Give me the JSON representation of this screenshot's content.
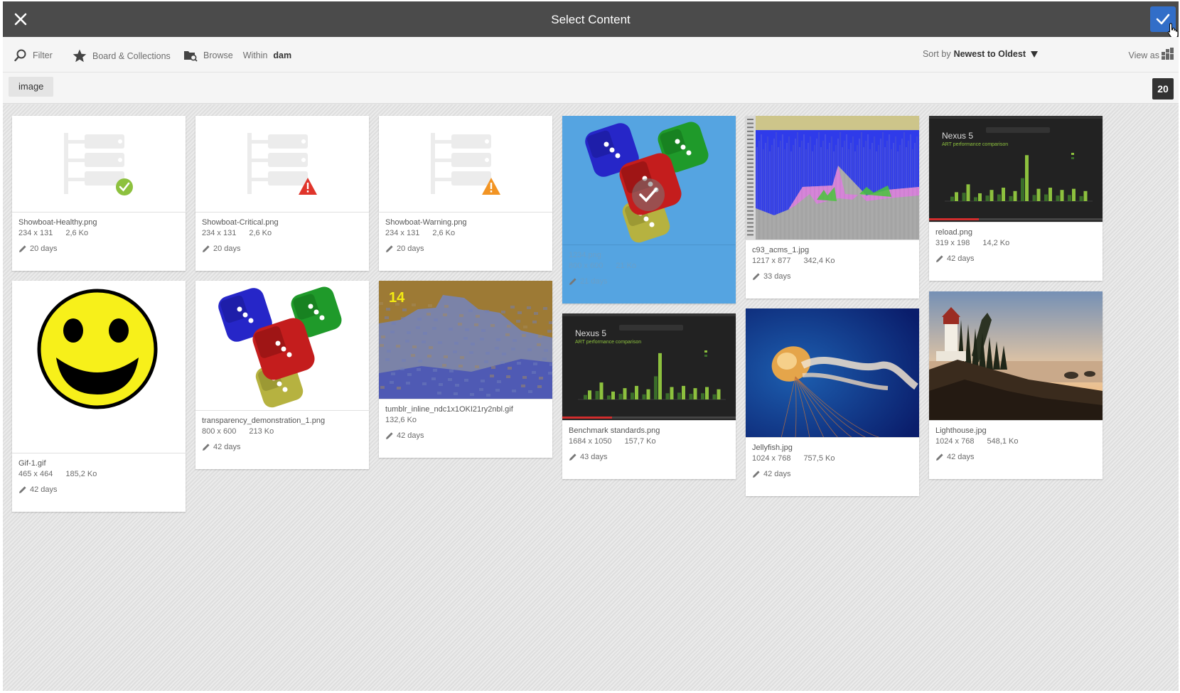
{
  "header": {
    "title": "Select Content",
    "close_icon": "close-icon",
    "confirm_icon": "check-icon",
    "accent_color": "#326ec8"
  },
  "toolbar": {
    "filter_label": "Filter",
    "board_label": "Board & Collections",
    "browse_label": "Browse",
    "within_label": "Within",
    "within_value": "dam",
    "sort_prefix": "Sort by",
    "sort_value": "Newest to Oldest",
    "view_label": "View as"
  },
  "tagbar": {
    "tag": "image",
    "count": "20"
  },
  "cards": [
    {
      "name": "Showboat-Healthy.png",
      "dims": "234 x 131",
      "size": "2,6 Ko",
      "modified": "20 days",
      "thumb": "status-healthy"
    },
    {
      "name": "Showboat-Critical.png",
      "dims": "234 x 131",
      "size": "2,6 Ko",
      "modified": "20 days",
      "thumb": "status-critical"
    },
    {
      "name": "Showboat-Warning.png",
      "dims": "234 x 131",
      "size": "2,6 Ko",
      "modified": "20 days",
      "thumb": "status-warning"
    },
    {
      "name": "1234.png",
      "dims": "800 x 600",
      "size": "21 Ko",
      "modified": "21 days",
      "thumb": "dice",
      "selected": true
    },
    {
      "name": "c93_acms_1.jpg",
      "dims": "1217 x 877",
      "size": "342,4 Ko",
      "modified": "33 days",
      "thumb": "spectrum"
    },
    {
      "name": "reload.png",
      "dims": "319 x 198",
      "size": "14,2 Ko",
      "modified": "42 days",
      "thumb": "benchmark"
    },
    {
      "name": "Gif-1.gif",
      "dims": "465 x 464",
      "size": "185,2 Ko",
      "modified": "42 days",
      "thumb": "smiley"
    },
    {
      "name": "transparency_demonstration_1.png",
      "dims": "800 x 600",
      "size": "213 Ko",
      "modified": "42 days",
      "thumb": "dice"
    },
    {
      "name": "tumblr_inline_ndc1x1OKI21ry2nbl.gif",
      "dims": "",
      "size": "132,6 Ko",
      "modified": "42 days",
      "thumb": "photo-noise",
      "overlay_text": "14"
    },
    {
      "name": "Benchmark standards.png",
      "dims": "1684 x 1050",
      "size": "157,7 Ko",
      "modified": "43 days",
      "thumb": "benchmark"
    },
    {
      "name": "Jellyfish.jpg",
      "dims": "1024 x 768",
      "size": "757,5 Ko",
      "modified": "42 days",
      "thumb": "jellyfish"
    },
    {
      "name": "Lighthouse.jpg",
      "dims": "1024 x 768",
      "size": "548,1 Ko",
      "modified": "42 days",
      "thumb": "lighthouse"
    }
  ],
  "benchmark_text": {
    "title": "Nexus 5",
    "subtitle": "ART performance comparison"
  }
}
